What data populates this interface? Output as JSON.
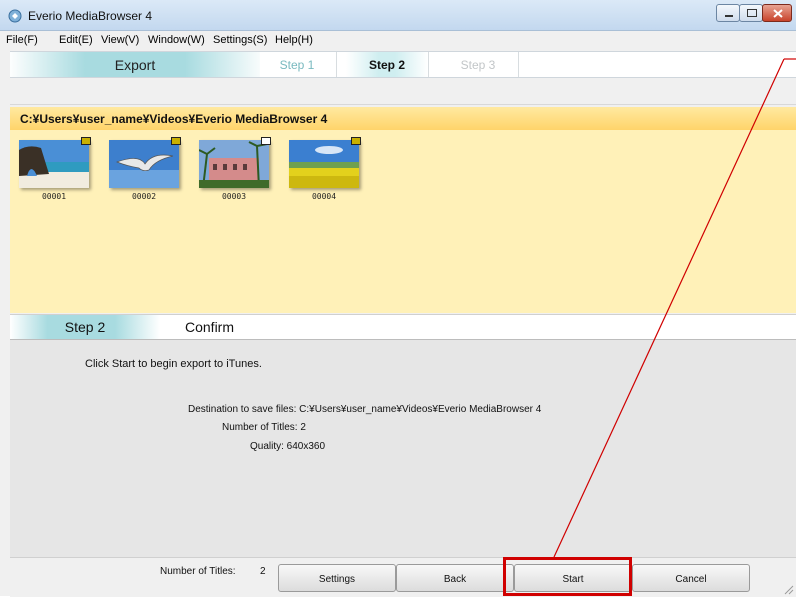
{
  "window": {
    "title": "Everio MediaBrowser 4",
    "icon": "app-icon",
    "controls": [
      "minimize-icon",
      "maximize-icon",
      "close-icon"
    ]
  },
  "menu": [
    "File(F)",
    "Edit(E)",
    "View(V)",
    "Window(W)",
    "Settings(S)",
    "Help(H)"
  ],
  "steps": {
    "mode": "Export",
    "items": [
      "Step 1",
      "Step 2",
      "Step 3"
    ],
    "active": "Step 2"
  },
  "path": "C:¥Users¥user_name¥Videos¥Everio MediaBrowser 4",
  "thumbnails": [
    {
      "label": "00001",
      "scene": "beach-rock",
      "badge": "yellow"
    },
    {
      "label": "00002",
      "scene": "seagull",
      "badge": "yellow"
    },
    {
      "label": "00003",
      "scene": "palm-building",
      "badge": "white"
    },
    {
      "label": "00004",
      "scene": "flower-field",
      "badge": "yellow"
    }
  ],
  "confirm": {
    "step_label": "Step 2",
    "title": "Confirm",
    "message": "Click Start to begin export to iTunes.",
    "destination": "Destination to save files: C:¥Users¥user_name¥Videos¥Everio MediaBrowser 4",
    "titles_count": "Number of Titles: 2",
    "quality": "Quality: 640x360"
  },
  "footer": {
    "number_of_titles_label": "Number of Titles:",
    "number_of_titles_value": "2",
    "buttons": {
      "settings": "Settings",
      "back": "Back",
      "start": "Start",
      "cancel": "Cancel"
    }
  },
  "annotation": {
    "color": "#d00000",
    "target": "Start"
  }
}
